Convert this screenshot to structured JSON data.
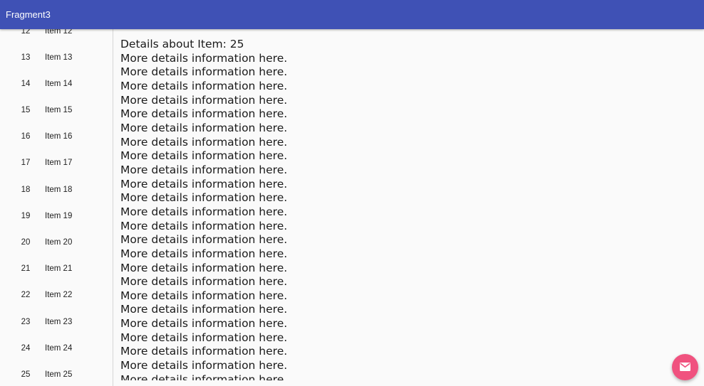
{
  "toolbar": {
    "title": "Fragment3"
  },
  "list": {
    "items": [
      {
        "id": "12",
        "content": "Item 12"
      },
      {
        "id": "13",
        "content": "Item 13"
      },
      {
        "id": "14",
        "content": "Item 14"
      },
      {
        "id": "15",
        "content": "Item 15"
      },
      {
        "id": "16",
        "content": "Item 16"
      },
      {
        "id": "17",
        "content": "Item 17"
      },
      {
        "id": "18",
        "content": "Item 18"
      },
      {
        "id": "19",
        "content": "Item 19"
      },
      {
        "id": "20",
        "content": "Item 20"
      },
      {
        "id": "21",
        "content": "Item 21"
      },
      {
        "id": "22",
        "content": "Item 22"
      },
      {
        "id": "23",
        "content": "Item 23"
      },
      {
        "id": "24",
        "content": "Item 24"
      },
      {
        "id": "25",
        "content": "Item 25"
      }
    ]
  },
  "detail": {
    "text": "Details about Item: 25\nMore details information here.\nMore details information here.\nMore details information here.\nMore details information here.\nMore details information here.\nMore details information here.\nMore details information here.\nMore details information here.\nMore details information here.\nMore details information here.\nMore details information here.\nMore details information here.\nMore details information here.\nMore details information here.\nMore details information here.\nMore details information here.\nMore details information here.\nMore details information here.\nMore details information here.\nMore details information here.\nMore details information here.\nMore details information here.\nMore details information here.\nMore details information here."
  },
  "fab": {
    "icon": "email-icon",
    "color": "#f0527f"
  },
  "colors": {
    "primary": "#3f51b5",
    "accent": "#f0527f",
    "background": "#fafafa"
  }
}
